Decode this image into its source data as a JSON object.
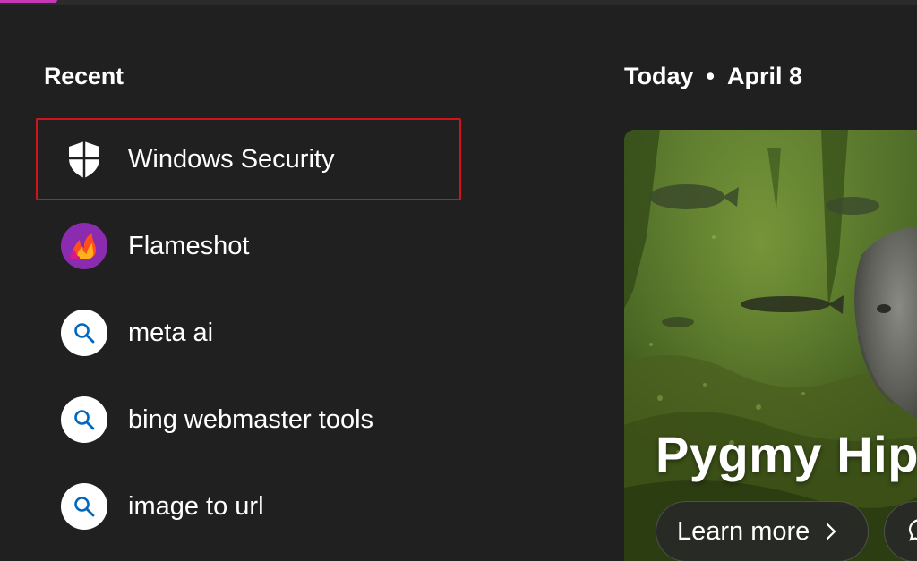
{
  "recent": {
    "heading": "Recent",
    "items": [
      {
        "label": "Windows Security",
        "icon": "shield-icon",
        "selected": true
      },
      {
        "label": "Flameshot",
        "icon": "flameshot-icon",
        "selected": false
      },
      {
        "label": "meta ai",
        "icon": "search-icon",
        "selected": false
      },
      {
        "label": "bing webmaster tools",
        "icon": "search-icon",
        "selected": false
      },
      {
        "label": "image to url",
        "icon": "search-icon",
        "selected": false
      }
    ]
  },
  "today": {
    "label": "Today",
    "separator": "•",
    "date": "April 8"
  },
  "hero": {
    "title": "Pygmy Hip",
    "learn_more_label": "Learn more",
    "chat_icon": "chat-icon"
  },
  "colors": {
    "background": "#202020",
    "selection_outline": "#d3131a",
    "search_icon": "#0067c0",
    "flameshot_bg": "#8a2bb0"
  }
}
